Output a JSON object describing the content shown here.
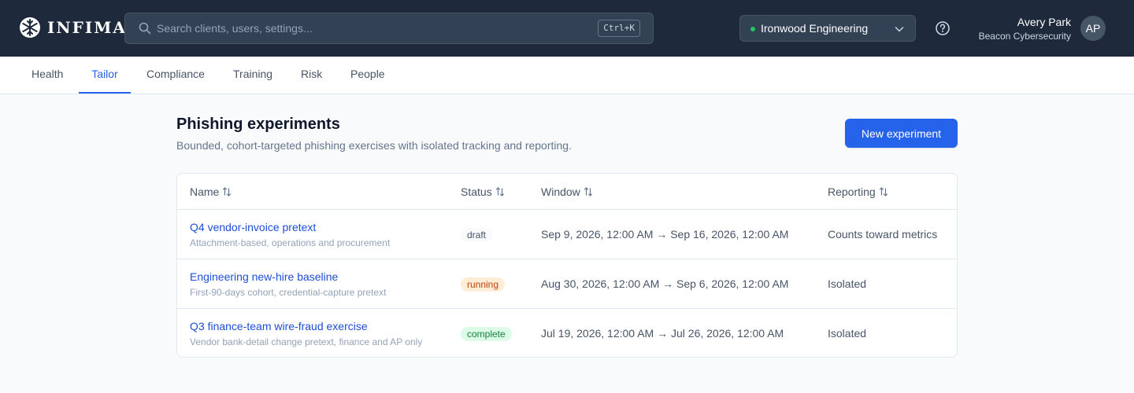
{
  "app": {
    "name": "INFIMA"
  },
  "search": {
    "placeholder": "Search clients, users, settings...",
    "shortcut": "Ctrl+K"
  },
  "org_selector": {
    "value": "Ironwood Engineering",
    "status_color": "#22c55e"
  },
  "user": {
    "name": "Avery Park",
    "org": "Beacon Cybersecurity",
    "initials": "AP"
  },
  "tabs": [
    {
      "label": "Health",
      "active": false
    },
    {
      "label": "Tailor",
      "active": true
    },
    {
      "label": "Compliance",
      "active": false
    },
    {
      "label": "Training",
      "active": false
    },
    {
      "label": "Risk",
      "active": false
    },
    {
      "label": "People",
      "active": false
    }
  ],
  "page": {
    "title": "Phishing experiments",
    "subtitle": "Bounded, cohort-targeted phishing exercises with isolated tracking and reporting.",
    "new_button": "New experiment"
  },
  "table": {
    "columns": [
      "Name",
      "Status",
      "Window",
      "Reporting"
    ],
    "rows": [
      {
        "name": "Q4 vendor-invoice pretext",
        "description": "Attachment-based, operations and procurement",
        "status": "draft",
        "window": "Sep 9, 2026, 12:00 AM → Sep 16, 2026, 12:00 AM",
        "reporting": "Counts toward metrics"
      },
      {
        "name": "Engineering new-hire baseline",
        "description": "First-90-days cohort, credential-capture pretext",
        "status": "running",
        "window": "Aug 30, 2026, 12:00 AM → Sep 6, 2026, 12:00 AM",
        "reporting": "Isolated"
      },
      {
        "name": "Q3 finance-team wire-fraud exercise",
        "description": "Vendor bank-detail change pretext, finance and AP only",
        "status": "complete",
        "window": "Jul 19, 2026, 12:00 AM → Jul 26, 2026, 12:00 AM",
        "reporting": "Isolated"
      }
    ]
  },
  "colors": {
    "topbar": "#1e293b",
    "accent": "#2563eb",
    "link": "#1d4ed8",
    "status_draft": "#475569",
    "status_running": "#c2410c",
    "status_complete": "#15803d"
  }
}
